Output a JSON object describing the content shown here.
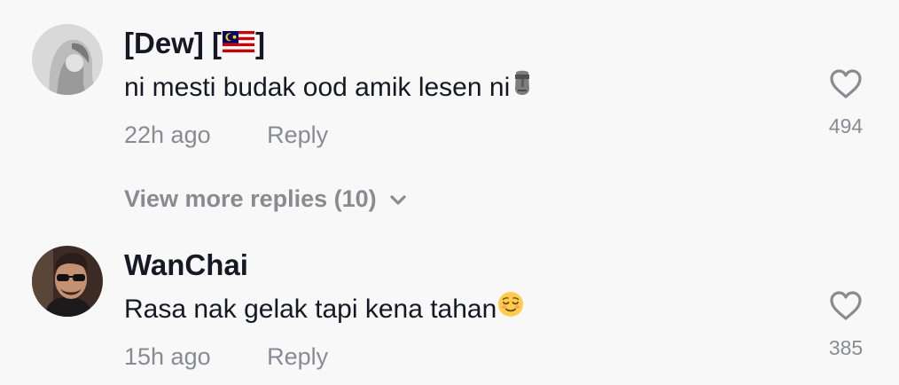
{
  "comments": [
    {
      "username_prefix": "[Dew] [",
      "username_suffix": "]",
      "flag_icon": "malaysia-flag-icon",
      "text": "ni mesti budak ood amik lesen ni",
      "text_emoji": "moai-emoji-icon",
      "time": "22h ago",
      "reply_label": "Reply",
      "like_count": "494"
    },
    {
      "username": "WanChai",
      "text": "Rasa nak gelak tapi kena tahan",
      "text_emoji": "relieved-face-emoji-icon",
      "time": "15h ago",
      "reply_label": "Reply",
      "like_count": "385"
    }
  ],
  "view_more_replies": "View more replies (10)",
  "colors": {
    "background": "#f8f8f8",
    "primary_text": "#161823",
    "secondary_text": "#8a8b91"
  }
}
